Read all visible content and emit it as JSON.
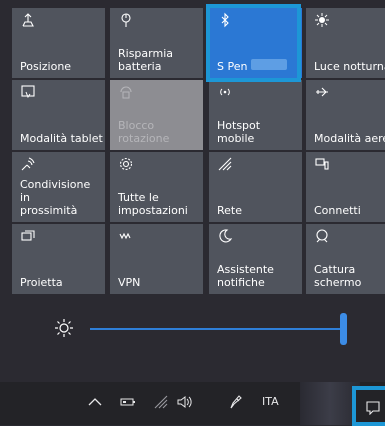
{
  "tiles": [
    {
      "label": "Posizione",
      "icon": "location-icon",
      "state": "normal"
    },
    {
      "label": "Risparmia\nbatteria",
      "icon": "battery-saver-icon",
      "state": "normal"
    },
    {
      "label": "S Pen",
      "icon": "bluetooth-icon",
      "state": "on"
    },
    {
      "label": "Luce notturna",
      "icon": "night-light-icon",
      "state": "normal"
    },
    {
      "label": "Modalità tablet",
      "icon": "tablet-mode-icon",
      "state": "normal"
    },
    {
      "label": "Blocco\nrotazione",
      "icon": "rotation-lock-icon",
      "state": "off"
    },
    {
      "label": "Hotspot mobile",
      "icon": "mobile-hotspot-icon",
      "state": "normal"
    },
    {
      "label": "Modalità aere",
      "icon": "airplane-icon",
      "state": "normal"
    },
    {
      "label": "Condivisione in\nprossimità",
      "icon": "nearby-share-icon",
      "state": "normal"
    },
    {
      "label": "Tutte le\nimpostazioni",
      "icon": "settings-icon",
      "state": "normal"
    },
    {
      "label": "Rete",
      "icon": "network-icon",
      "state": "normal"
    },
    {
      "label": "Connetti",
      "icon": "connect-icon",
      "state": "normal"
    },
    {
      "label": "Proietta",
      "icon": "project-icon",
      "state": "normal"
    },
    {
      "label": "VPN",
      "icon": "vpn-icon",
      "state": "normal"
    },
    {
      "label": "Assistente\nnotifiche",
      "icon": "focus-assist-icon",
      "state": "normal"
    },
    {
      "label": "Cattura\nschermo",
      "icon": "screen-snip-icon",
      "state": "normal"
    }
  ],
  "brightness": {
    "icon": "brightness-icon",
    "value": 1.0
  },
  "taskbar": {
    "language": "ITA"
  }
}
